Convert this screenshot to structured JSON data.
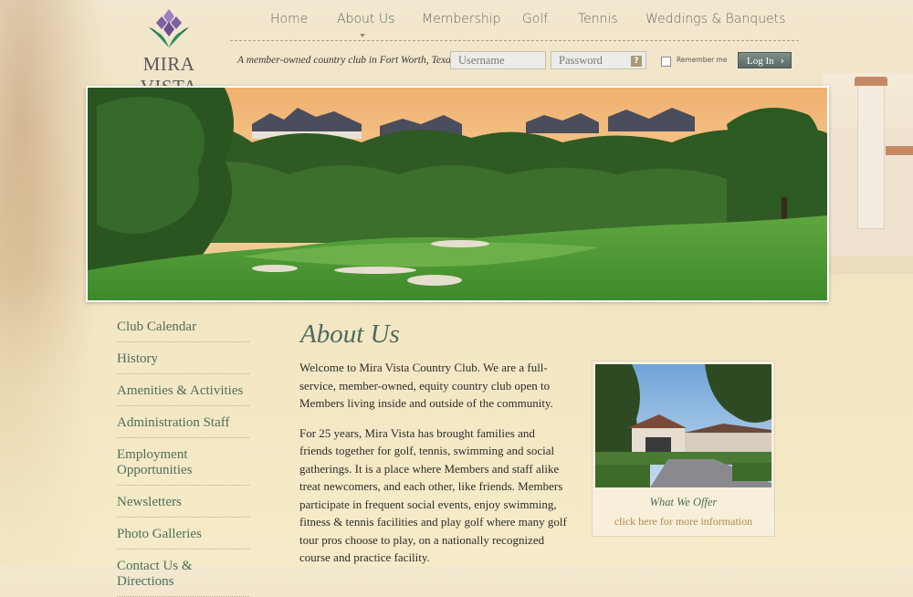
{
  "logo": {
    "text": "MIRA VISTA"
  },
  "nav": {
    "items": [
      {
        "label": "Home"
      },
      {
        "label": "About Us",
        "active": true
      },
      {
        "label": "Membership"
      },
      {
        "label": "Golf"
      },
      {
        "label": "Tennis"
      },
      {
        "label": "Weddings & Banquets"
      }
    ]
  },
  "tagline": "A member-owned country club in Fort Worth, Texas",
  "login": {
    "username_placeholder": "Username",
    "password_placeholder": "Password",
    "help_icon": "?",
    "remember_label": "Remember me",
    "button_label": "Log In",
    "button_icon": "›"
  },
  "sidebar": {
    "items": [
      {
        "label": "Club Calendar"
      },
      {
        "label": "History"
      },
      {
        "label": "Amenities & Activities"
      },
      {
        "label": "Administration Staff"
      },
      {
        "label": "Employment Opportunities"
      },
      {
        "label": "Newsletters"
      },
      {
        "label": "Photo Galleries"
      },
      {
        "label": "Contact Us & Directions"
      }
    ]
  },
  "main": {
    "title": "About Us",
    "paragraphs": [
      "Welcome to Mira Vista Country Club. We are a full-service, member-owned, equity country club open to Members living inside and outside of the community.",
      "For 25 years, Mira Vista has brought families and friends together for golf, tennis, swimming and social gatherings. It is a place where Members and staff alike treat newcomers, and each other, like friends. Members participate in frequent social events, enjoy swimming, fitness & tennis facilities and play golf where many golf tour pros choose to play, on a nationally recognized course and practice facility."
    ]
  },
  "card": {
    "title": "What We Offer",
    "link": "click here for more information"
  },
  "colors": {
    "brand_green": "#4e6e5e",
    "logo_purple": "#7d5fa5",
    "logo_green": "#1f6a4f",
    "link_gold": "#b08a4e"
  }
}
